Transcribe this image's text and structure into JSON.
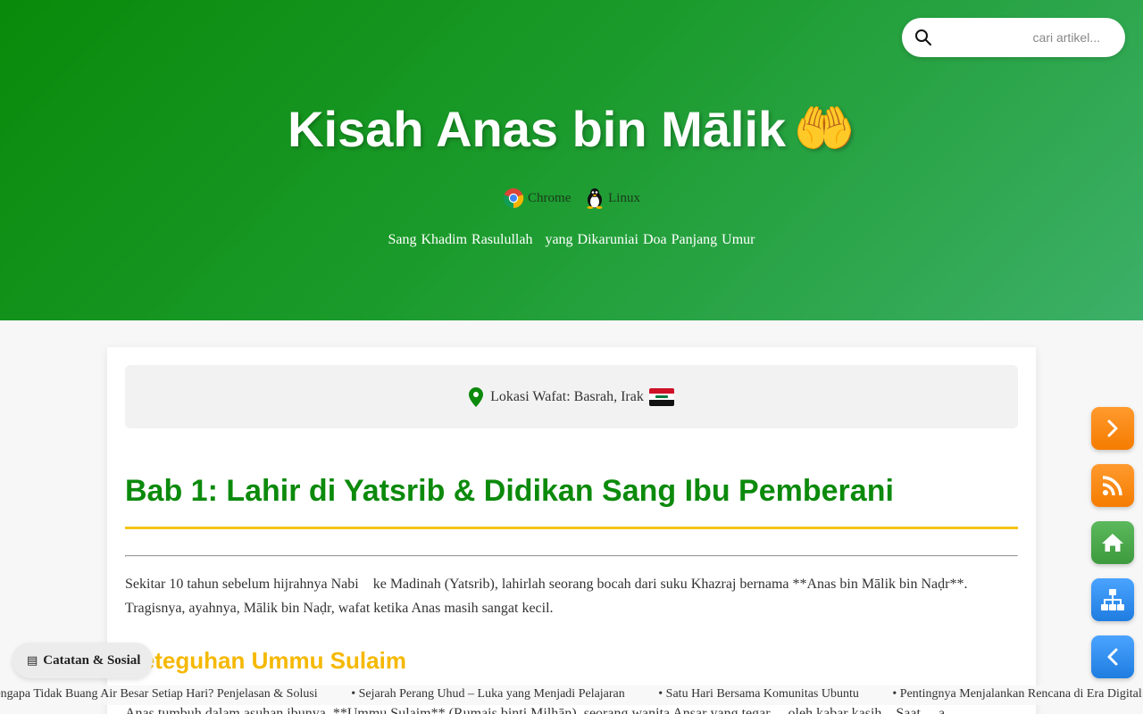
{
  "search": {
    "placeholder": "cari artikel..."
  },
  "hero": {
    "title": "Kisah Anas bin Mālik",
    "title_emoji": "🤲",
    "browsers": [
      {
        "label": "Chrome",
        "icon": "chrome-icon"
      },
      {
        "label": "Linux",
        "icon": "linux-tux-icon"
      }
    ],
    "subtitle_part1": "Sang Khadim Rasulullah",
    "subtitle_part2": "yang Dikaruniai Doa Panjang Umur"
  },
  "location": {
    "text": "Lokasi Wafat: Basrah, Irak",
    "flag": "iraq-flag"
  },
  "article": {
    "chapter_title": "Bab 1: Lahir di Yatsrib & Didikan Sang Ibu Pemberani",
    "paragraph_part1": "Sekitar 10 tahun sebelum hijrahnya Nabi",
    "paragraph_part2": "ke Madinah (Yatsrib), lahirlah seorang bocah dari suku Khazraj bernama **Anas bin Mālik bin Naḍr**.",
    "paragraph_line2": "Tragisnya, ayahnya, Mālik bin Naḍr, wafat ketika Anas masih sangat kecil.",
    "subheading": "Keteguhan Ummu Sulaim",
    "cut_line": "Anas tumbuh dalam asuhan ibunya, **Ummu Sulaim** (Rumaiṣ binti Milḥān), seorang wanita Anṣar yang tegar ... oleh kabar kasih... Saat ... a"
  },
  "badge": {
    "icon": "newspaper-icon",
    "label": "Catatan & Sosial"
  },
  "ticker": [
    "Mengapa Tidak Buang Air Besar Setiap Hari? Penjelasan & Solusi",
    "• Sejarah Perang Uhud – Luka yang Menjadi Pelajaran",
    "• Satu Hari Bersama Komunitas Ubuntu",
    "• Pentingnya Menjalankan Rencana di Era Digital: Strategi Efektif"
  ],
  "fabs": [
    {
      "name": "next-button",
      "icon": "chevron-right-icon",
      "color": "#f57c00"
    },
    {
      "name": "rss-button",
      "icon": "rss-icon",
      "color": "#f57c00"
    },
    {
      "name": "home-button",
      "icon": "home-icon",
      "color": "#3d9a3d"
    },
    {
      "name": "sitemap-button",
      "icon": "sitemap-icon",
      "color": "#1f7de0"
    },
    {
      "name": "back-button",
      "icon": "chevron-left-icon",
      "color": "#1f7de0"
    }
  ],
  "colors": {
    "hero_green": "#0a8a0a",
    "chapter_green": "#0c8a0c",
    "accent_yellow": "#f5c518",
    "subheading_yellow": "#f5b800"
  }
}
